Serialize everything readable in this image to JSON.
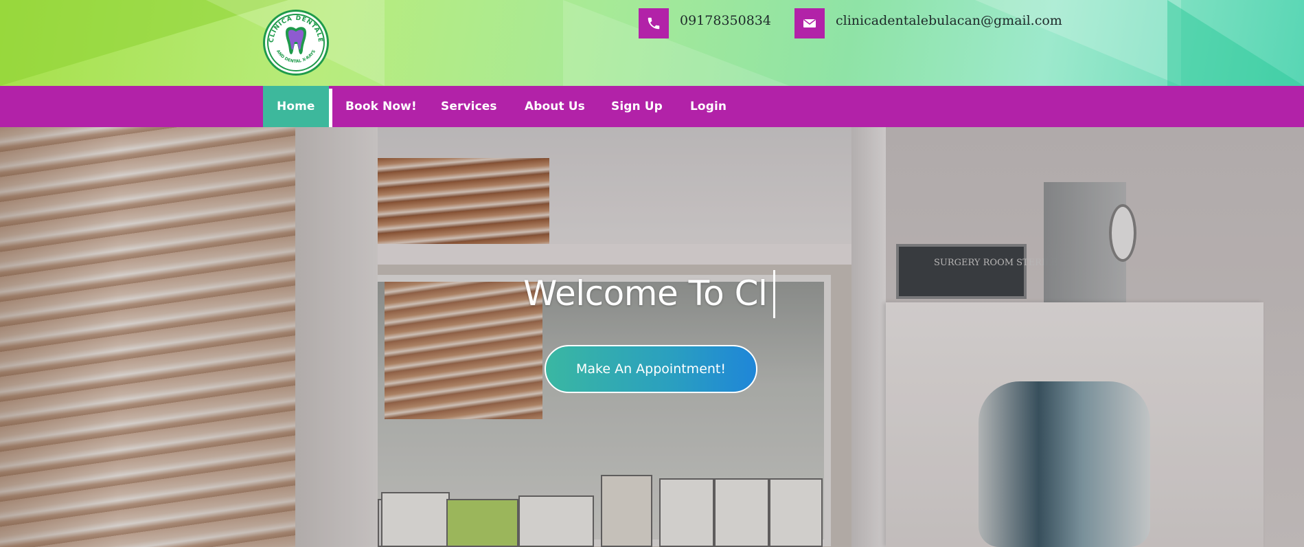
{
  "brand": {
    "logo_ring_text": "CLINICA DENTALE",
    "logo_sub_text": "AND DENTAL X-RAYS",
    "colors": {
      "primary": "#b222a8",
      "accent": "#3db89c",
      "logo_green": "#1f9a4b"
    }
  },
  "contact": {
    "phone": {
      "icon": "phone-icon",
      "text": "09178350834"
    },
    "email": {
      "icon": "envelope-icon",
      "text": "clinicadentalebulacan@gmail.com"
    }
  },
  "nav": {
    "items": [
      {
        "label": "Home",
        "active": true
      },
      {
        "label": "Book Now!",
        "active": false
      },
      {
        "label": "Services",
        "active": false
      },
      {
        "label": "About Us",
        "active": false
      },
      {
        "label": "Sign Up",
        "active": false
      },
      {
        "label": "Login",
        "active": false
      }
    ]
  },
  "hero": {
    "title_typed": "Welcome To Cl",
    "cta_label": "Make An Appointment!",
    "door_sign": "SURGERY ROOM STERILE"
  }
}
